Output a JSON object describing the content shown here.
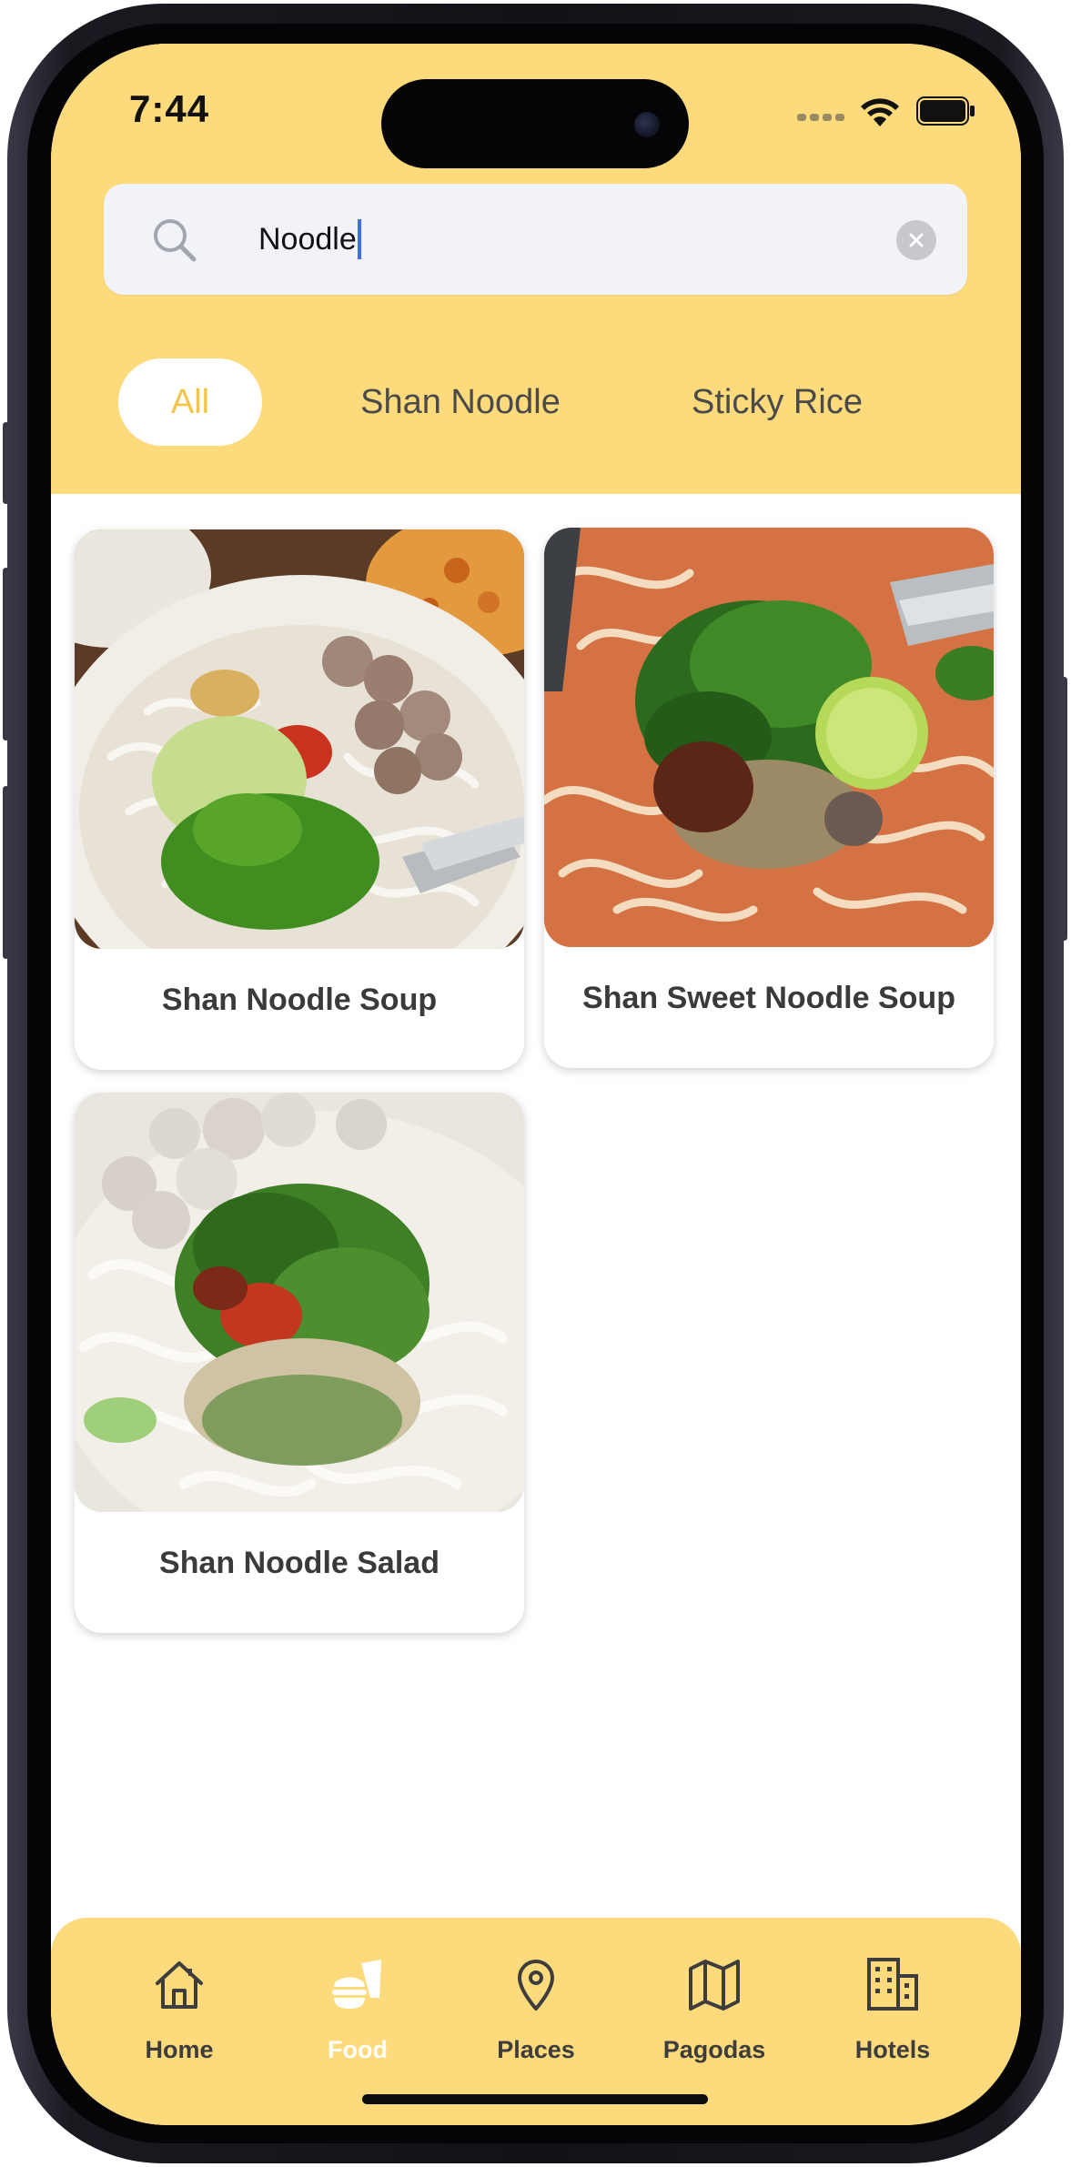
{
  "status_bar": {
    "time": "7:44"
  },
  "search": {
    "value": "Noodle"
  },
  "filters": [
    {
      "label": "All",
      "active": true
    },
    {
      "label": "Shan Noodle",
      "active": false
    },
    {
      "label": "Sticky Rice",
      "active": false
    }
  ],
  "results": [
    {
      "title": "Shan Noodle Soup"
    },
    {
      "title": "Shan Sweet Noodle Soup"
    },
    {
      "title": "Shan Noodle Salad"
    }
  ],
  "tabs": [
    {
      "label": "Home",
      "icon": "home-icon",
      "active": false
    },
    {
      "label": "Food",
      "icon": "food-icon",
      "active": true
    },
    {
      "label": "Places",
      "icon": "location-pin-icon",
      "active": false
    },
    {
      "label": "Pagodas",
      "icon": "map-icon",
      "active": false
    },
    {
      "label": "Hotels",
      "icon": "building-icon",
      "active": false
    }
  ],
  "colors": {
    "header": "#fdda7c",
    "accent": "#f5c44a",
    "search_bg": "#f1f3f8"
  }
}
